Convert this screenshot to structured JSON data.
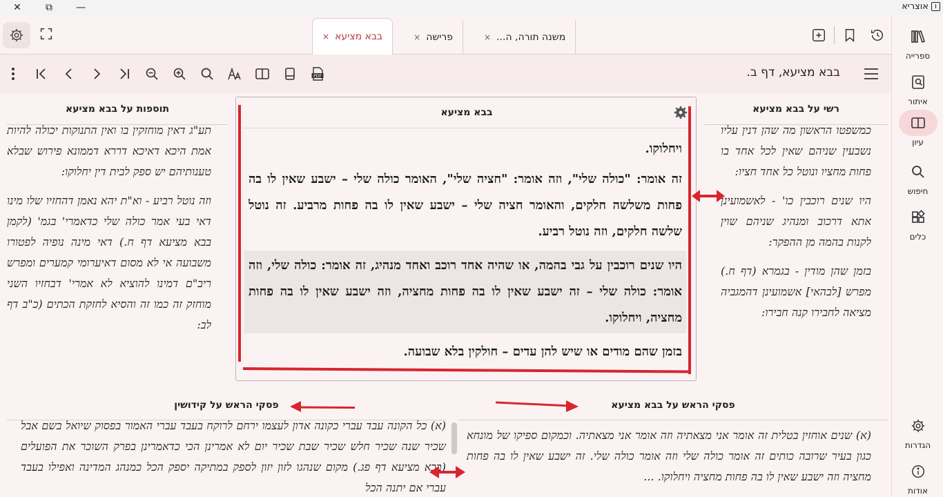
{
  "app": {
    "title": "אוצריא"
  },
  "window_controls": {
    "close": "✕",
    "maximize": "⧉",
    "minimize": "—"
  },
  "rail": {
    "items": [
      {
        "label": "ספרייה",
        "icon": "library-icon"
      },
      {
        "label": "איתור",
        "icon": "locate-icon"
      },
      {
        "label": "עיון",
        "icon": "book-open-icon",
        "active": true
      },
      {
        "label": "חיפוש",
        "icon": "search-icon"
      },
      {
        "label": "כלים",
        "icon": "tools-icon"
      }
    ],
    "bottom": [
      {
        "label": "הגדרות",
        "icon": "gear-icon"
      },
      {
        "label": "אודות",
        "icon": "info-icon"
      }
    ]
  },
  "tabs": [
    {
      "label": "בבא מציעא",
      "close": "×",
      "active": true
    },
    {
      "label": "פרישה",
      "close": "×"
    },
    {
      "label": "משנה תורה, ה...",
      "close": "×"
    }
  ],
  "toolbar": {
    "page_title": "בבא מציעא, דף ב."
  },
  "panels": {
    "tosafot": {
      "title": "תוספות על בבא מציעא",
      "paragraphs": [
        "תע\"ג דאין מוחזקין בו ואין התנוקות יכולה להיות אמת היכא דאיכא דררא דממונא פירוש שבלא טענותיהם יש ספק לבית דין יחלוקו:",
        "וזה נוטל רביע - וא\"ת יהא נאמן דהחזיו שלו מינו דאי בעי אמר כולה שלי כדאמרי' בגמ' (לקמן בבא מציעא דף ח.) דאי מינה נופיה לפטורו משבועה אי לא מסום דאיערומי קמערים ומפרש ריב\"ם דמינו להוציא לא אמרי' דבחזיו השני מוחזק זה כמו זה והסיא לחזקת הכתים (כ\"ב דף לב:"
      ]
    },
    "main": {
      "title": "בבא מציעא",
      "top_line": "ויחלוקו.",
      "para1": "זה אומר: \"כולה שלי\", וזה אומר: \"חציה שלי\", האומר כולה שלי – ישבע שאין לו בה פחות משלשה חלקים, והאומר חציה שלי – ישבע שאין לו בה פחות מרביע. זה נוטל שלשה חלקים, וזה נוטל רביע.",
      "para2": "היו שנים רוכבין על גבי בהמה, או שהיה אחד רוכב ואחד מנהיג, זה אומר: כולה שלי, וזה אומר: כולה שלי – זה ישבע שאין לו בה פחות מחציה, וזה ישבע שאין לו בה פחות מחציה, ויחלוקו.",
      "para3": "בזמן שהם מודים או שיש להן עדים – חולקין בלא שבועה."
    },
    "rashi": {
      "title": "רשי על בבא מציעא",
      "paragraphs": [
        "כמשפטו הראשון מה שהן דנין עליו נשבעין שניהם שאין לכל אחד בו פחות מחציו ונוטל כל אחד חציו:",
        "היו שנים רוכבין כו' - לאשמועינן אתא דרכוב ומנהיג שניהם שוין לקנות בהמה מן ההפקר:",
        "בזמן שהן מודין - בגמרא (דף ח.) מפרש [לבהאי] אשמועינן דהמגביה מציאה לחבירו קנה חבירו:"
      ]
    },
    "piskei_kiddushin": {
      "title": "פסקי הראש על קידושין",
      "text": "(א) כל הקונה עבד עברי כקונה אדון לעצמו ירחם לרוקח בעבד עברי האמור בפסוק שיואל בשם אבל שכיר שנה שכיר חלש שכיר שבת שכיר יום לא אמרינן הכי כדאמרינן בפרק השוכר את הפועלים (בבא מציעא דף פג.) מקום שנהגו לזון יזון לספק במתיקה יספק הכל כמנהג המדינה ואפילו בעבד עברי אם יתנה הכל"
    },
    "piskei_bm": {
      "title": "פסקי הראש על בבא מציעא",
      "text": "(א) שנים אוחזין בטלית זה אומר אני מצאתיה וזה אומר אני מצאתיה. וכמקום ספיקו של מונחא כגון בעיר שרובה כותים זה אומר כולה שלי וזה אומר כולה שלי. זה ישבע שאין לו בה פחות מחציה וזה ישבע שאין לו בה פחות מחציה ויחלוקו. ..."
    }
  },
  "accent_color": "#b53a44",
  "annotation_color": "#d7262f"
}
